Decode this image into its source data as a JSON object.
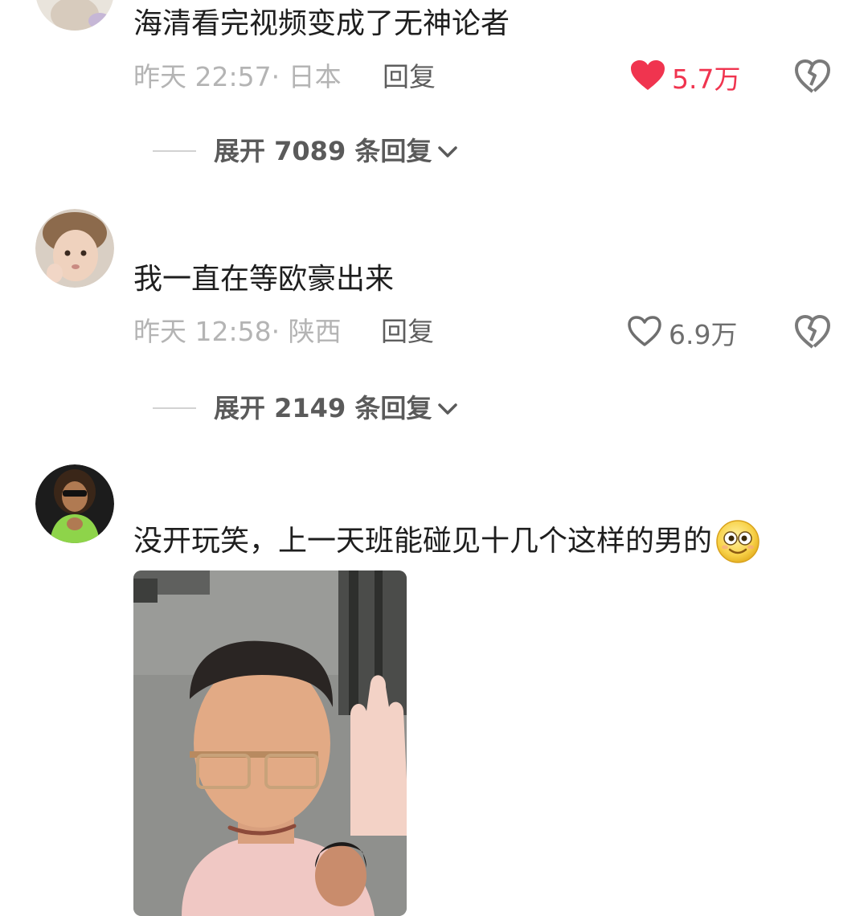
{
  "comments": [
    {
      "text": "海清看完视频变成了无神论者",
      "meta": "昨天 22:57· 日本",
      "reply_label": "回复",
      "likes": "5.7万",
      "liked": true,
      "expand_label": "展开 7089 条回复"
    },
    {
      "text": "我一直在等欧豪出来",
      "meta": "昨天 12:58· 陕西",
      "reply_label": "回复",
      "likes": "6.9万",
      "liked": false,
      "expand_label": "展开 2149 条回复"
    },
    {
      "text": "没开玩笑，上一天班能碰见十几个这样的男的",
      "emoji": "smiling-face-emoji"
    }
  ],
  "colors": {
    "like_active": "#f0344f",
    "meta_gray": "#b4b4b4"
  },
  "icons": [
    "heart-filled-icon",
    "heart-outline-icon",
    "broken-heart-icon",
    "chevron-down-icon"
  ]
}
